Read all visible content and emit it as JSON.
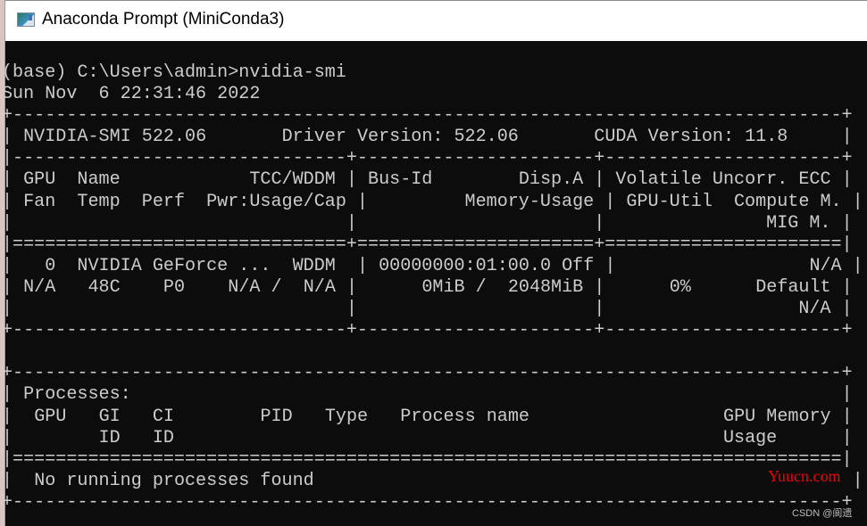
{
  "window": {
    "title": "Anaconda Prompt (MiniConda3)",
    "icon": "console-window-icon"
  },
  "terminal": {
    "prompt": "(base) C:\\Users\\admin>",
    "command": "nvidia-smi",
    "timestamp": "Sun Nov  6 22:31:46 2022",
    "header": {
      "smi_label": "NVIDIA-SMI",
      "smi_version": "522.06",
      "driver_label": "Driver Version:",
      "driver_version": "522.06",
      "cuda_label": "CUDA Version:",
      "cuda_version": "11.8"
    },
    "gpu_columns": {
      "col1_line1": "GPU  Name            TCC/WDDM",
      "col1_line2": "Fan  Temp  Perf  Pwr:Usage/Cap",
      "col2_line1": "Bus-Id        Disp.A",
      "col2_line2": "Memory-Usage",
      "col3_line1": "Volatile Uncorr. ECC",
      "col3_line2": "GPU-Util  Compute M.",
      "col3_line3": "MIG M."
    },
    "gpus": [
      {
        "index": "0",
        "name": "NVIDIA GeForce ...",
        "driver_model": "WDDM",
        "bus_id": "00000000:01:00.0",
        "disp_a": "Off",
        "ecc": "N/A",
        "fan": "N/A",
        "temp": "48C",
        "perf": "P0",
        "pwr_usage": "N/A",
        "pwr_cap": "N/A",
        "memory_used": "0MiB",
        "memory_total": "2048MiB",
        "gpu_util": "0%",
        "compute_mode": "Default",
        "mig_mode": "N/A"
      }
    ],
    "processes": {
      "title": "Processes:",
      "headers_line1": [
        "GPU",
        "GI",
        "CI",
        "PID",
        "Type",
        "Process name",
        "GPU Memory"
      ],
      "headers_line2": [
        "ID",
        "ID",
        "Usage"
      ],
      "empty_message": "No running processes found"
    }
  },
  "overlays": {
    "watermark": "Yuucn.com",
    "credit": "CSDN @阆遗"
  }
}
